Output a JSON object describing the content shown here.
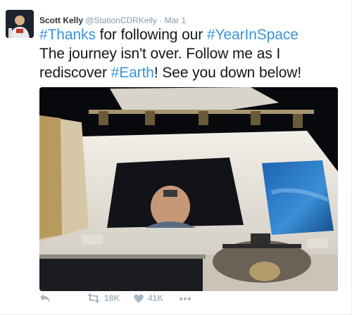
{
  "tweet": {
    "author_name": "Scott Kelly",
    "handle": "@StationCDRKelly",
    "separator": "·",
    "time": "Mar 1",
    "text": {
      "hashtag1": "#Thanks",
      "seg1": " for following our ",
      "hashtag2": "#YearInSpace",
      "seg2": "The journey isn't over. Follow me as I rediscover ",
      "hashtag3": "#Earth",
      "seg3": "! See you down below!"
    },
    "actions": {
      "reply_icon": "reply-icon",
      "retweet_icon": "retweet-icon",
      "retweet_count": "18K",
      "like_icon": "heart-icon",
      "like_count": "41K",
      "more_icon": "more-dots-icon"
    },
    "colors": {
      "hashtag": "#3b94d9",
      "action_gray": "#aab8c2"
    }
  }
}
